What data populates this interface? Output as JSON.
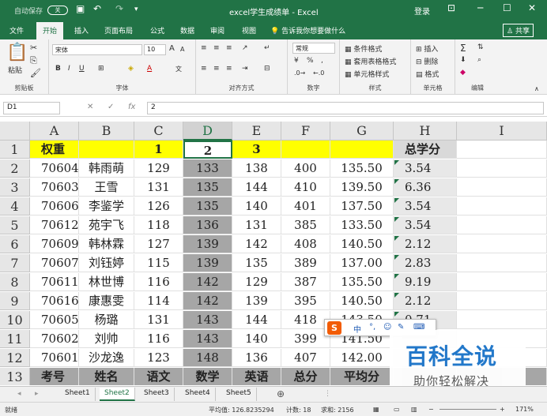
{
  "titlebar": {
    "autosave": "自动保存",
    "toggle": "关",
    "title": "excel学生成绩单  -  Excel",
    "login": "登录"
  },
  "tabs": [
    "文件",
    "开始",
    "插入",
    "页面布局",
    "公式",
    "数据",
    "审阅",
    "视图"
  ],
  "active_tab": "开始",
  "tellme": "告诉我你想要做什么",
  "share": "共享",
  "ribbon": {
    "paste": "粘贴",
    "clipboard": "剪贴板",
    "font_name": "宋体",
    "font_size": "10",
    "font_group": "字体",
    "align_group": "对齐方式",
    "number_format": "常规",
    "number_group": "数字",
    "cond_format": "条件格式",
    "table_format": "套用表格格式",
    "cell_style": "单元格样式",
    "style_group": "样式",
    "insert": "插入",
    "delete": "删除",
    "format": "格式",
    "cells_group": "单元格",
    "edit_group": "编辑"
  },
  "formula_bar": {
    "name_box": "D1",
    "value": "2",
    "fx": "fx"
  },
  "columns": [
    "A",
    "B",
    "C",
    "D",
    "E",
    "F",
    "G",
    "H",
    "I"
  ],
  "rows": [
    [
      "权重",
      "",
      "1",
      "2",
      "3",
      "",
      "",
      "总学分",
      ""
    ],
    [
      "70604",
      "韩雨萌",
      "129",
      "133",
      "138",
      "400",
      "135.50",
      "3.54",
      ""
    ],
    [
      "70603",
      "王雪",
      "131",
      "135",
      "144",
      "410",
      "139.50",
      "6.36",
      ""
    ],
    [
      "70606",
      "李鉴学",
      "126",
      "135",
      "140",
      "401",
      "137.50",
      "3.54",
      ""
    ],
    [
      "70612",
      "苑宇飞",
      "118",
      "136",
      "131",
      "385",
      "133.50",
      "3.54",
      ""
    ],
    [
      "70609",
      "韩林霖",
      "127",
      "139",
      "142",
      "408",
      "140.50",
      "2.12",
      ""
    ],
    [
      "70607",
      "刘钰婷",
      "115",
      "139",
      "135",
      "389",
      "137.00",
      "2.83",
      ""
    ],
    [
      "70611",
      "林世博",
      "116",
      "142",
      "129",
      "387",
      "135.50",
      "9.19",
      ""
    ],
    [
      "70616",
      "康惠雯",
      "114",
      "142",
      "139",
      "395",
      "140.50",
      "2.12",
      ""
    ],
    [
      "70605",
      "杨璐",
      "131",
      "143",
      "144",
      "418",
      "143.50",
      "0.71",
      ""
    ],
    [
      "70602",
      "刘帅",
      "116",
      "143",
      "140",
      "399",
      "141.50",
      "",
      ""
    ],
    [
      "70601",
      "沙龙逸",
      "123",
      "148",
      "136",
      "407",
      "142.00",
      "",
      ""
    ],
    [
      "考号",
      "姓名",
      "语文",
      "数学",
      "英语",
      "总分",
      "平均分",
      "",
      ""
    ]
  ],
  "sheets": [
    "Sheet1",
    "Sheet2",
    "Sheet3",
    "Sheet4",
    "Sheet5"
  ],
  "active_sheet": "Sheet2",
  "status": {
    "ready": "就绪",
    "average": "平均值: 126.8235294",
    "count": "计数: 18",
    "sum": "求和: 2156",
    "zoom": "171%"
  },
  "ime": {
    "items": [
      "中",
      "°,",
      "☺",
      "✎",
      "⌨"
    ]
  },
  "watermark": {
    "big": "百科全说",
    "small": "助你轻松解决"
  },
  "colors": {
    "excel_green": "#217346",
    "highlight_yellow": "#ffff00",
    "selected_col": "#a6a6a6"
  }
}
